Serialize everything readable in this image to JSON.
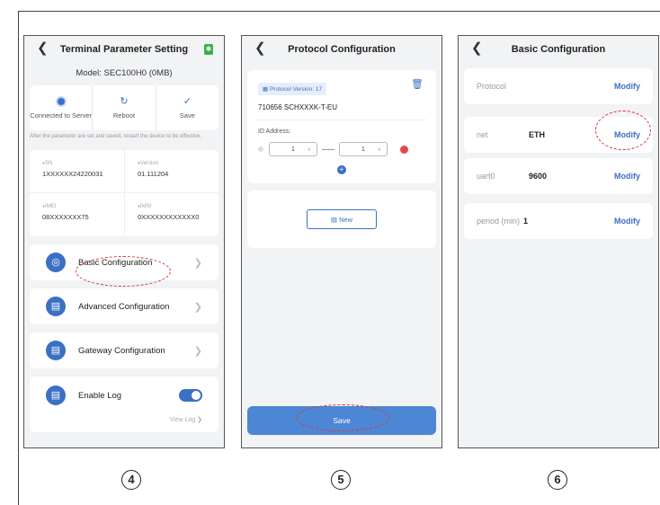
{
  "steps": [
    "4",
    "5",
    "6"
  ],
  "panel4": {
    "title": "Terminal Parameter Setting",
    "bt_icon": "bluetooth-icon",
    "model": "Model: SEC100H0 (0MB)",
    "actions": [
      {
        "label": "Connected to Server",
        "icon": "server-dot-icon"
      },
      {
        "label": "Reboot",
        "icon": "reboot-icon"
      },
      {
        "label": "Save",
        "icon": "save-check-icon"
      }
    ],
    "note": "After the parameter are set and saved, restart the device to be effective.",
    "info": [
      {
        "label": "SN",
        "value": "1XXXXXX24220031"
      },
      {
        "label": "Version",
        "value": "01.111204"
      },
      {
        "label": "IMEI",
        "value": "08XXXXXXX75"
      },
      {
        "label": "IMSI",
        "value": "0XXXXXXXXXXXX0"
      }
    ],
    "menu": [
      {
        "label": "Basic Configuration",
        "icon": "globe-icon"
      },
      {
        "label": "Advanced Configuration",
        "icon": "router-icon"
      },
      {
        "label": "Gateway Configuration",
        "icon": "router-icon"
      }
    ],
    "log": {
      "label": "Enable Log",
      "enabled": true,
      "view": "View Log"
    }
  },
  "panel5": {
    "title": "Protocol Configuration",
    "tag": "Protocol Version: 17",
    "name": "710656 SCHXXXK-T-EU",
    "id_label": "ID Address:",
    "id_from": "1",
    "id_to": "1",
    "new_label": "New",
    "save_label": "Save"
  },
  "panel6": {
    "title": "Basic Configuration",
    "rows": [
      {
        "key": "Protocol",
        "value": "",
        "action": "Modify"
      },
      {
        "key": "net",
        "value": "ETH",
        "action": "Modify"
      },
      {
        "key": "uart0",
        "value": "9600",
        "action": "Modify"
      },
      {
        "key": "period (min)",
        "value": "1",
        "action": "Modify"
      }
    ]
  },
  "colors": {
    "accent": "#3b70c4",
    "save_button": "#4c86d4",
    "highlight": "#d23a3a",
    "danger": "#e24a4a"
  }
}
